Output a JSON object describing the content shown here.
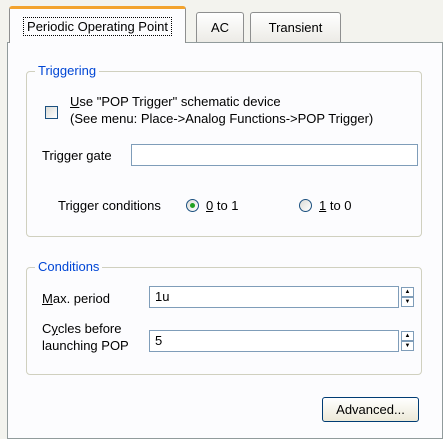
{
  "tabs": [
    {
      "label": "Periodic Operating Point",
      "active": true
    },
    {
      "label": "AC",
      "active": false
    },
    {
      "label": "Transient",
      "active": false
    }
  ],
  "triggering": {
    "legend": "Triggering",
    "use_pop_label_prefix": "U",
    "use_pop_label_rest": "se \"POP Trigger\" schematic device",
    "use_pop_note": "(See menu: Place->Analog Functions->POP Trigger)",
    "use_pop_checked": false,
    "trigger_gate_label": "Trigger gate",
    "trigger_gate_value": "",
    "conditions_label": "Trigger conditions",
    "option_0to1_key": "0",
    "option_0to1_rest": " to 1",
    "option_1to0_key": "1",
    "option_1to0_rest": " to 0",
    "selected": "0 to 1"
  },
  "conditions": {
    "legend": "Conditions",
    "max_period_key": "M",
    "max_period_rest": "ax. period",
    "max_period_value": "1u",
    "cycles_label_line1_pre": "C",
    "cycles_label_line1_key": "y",
    "cycles_label_line1_rest": "cles before",
    "cycles_label_line2": "launching POP",
    "cycles_value": "5"
  },
  "advanced_prefix": "Advanced",
  "advanced_suffix": "...",
  "accent_colors": {
    "tab_highlight": "#f3a32e",
    "group_legend": "#0046d5",
    "radio_dot": "#21a121"
  }
}
